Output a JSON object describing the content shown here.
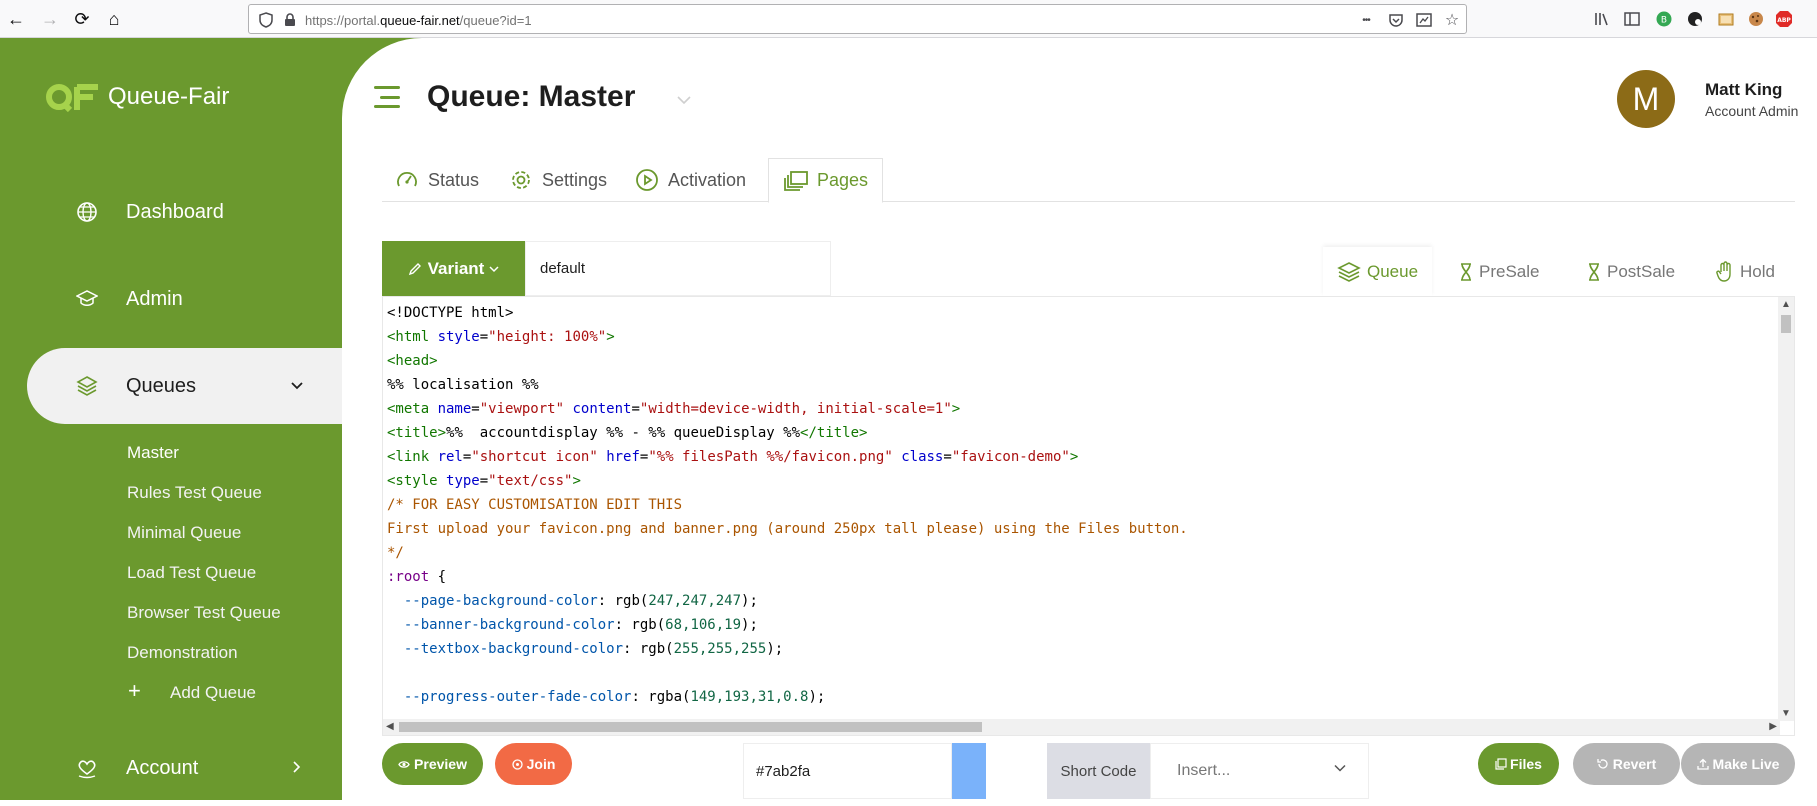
{
  "browser": {
    "back": "←",
    "forward": "→",
    "reload": "⟳",
    "home": "⌂",
    "url_prefix": "https://portal.",
    "url_domain": "queue-fair.net",
    "url_path": "/queue?id=1",
    "more": "•••"
  },
  "sidebar": {
    "brand": "Queue-Fair",
    "nav": [
      {
        "label": "Dashboard",
        "icon": "globe-icon"
      },
      {
        "label": "Admin",
        "icon": "graduation-cap-icon"
      },
      {
        "label": "Queues",
        "icon": "layers-icon"
      },
      {
        "label": "Account",
        "icon": "heart-hand-icon"
      }
    ],
    "queues": [
      "Master",
      "Rules Test Queue",
      "Minimal Queue",
      "Load Test Queue",
      "Browser Test Queue",
      "Demonstration"
    ],
    "add_queue": "Add Queue"
  },
  "header": {
    "title": "Queue: Master",
    "avatar_letter": "M",
    "user_name": "Matt King",
    "user_role": "Account Admin"
  },
  "tabs": [
    "Status",
    "Settings",
    "Activation",
    "Pages"
  ],
  "editor": {
    "variant_label": "Variant",
    "variant_value": "default",
    "page_tabs": [
      "Queue",
      "PreSale",
      "PostSale",
      "Hold"
    ]
  },
  "code": {
    "l1": "<!DOCTYPE html>",
    "l2_tag": "<html ",
    "l2_attr": "style",
    "l2_eq": "=",
    "l2_str": "\"height: 100%\"",
    "l2_end": ">",
    "l3": "<head>",
    "l4": "%% localisation %%",
    "l5_tag": "<meta ",
    "l5_a1": "name",
    "l5_s1": "\"viewport\"",
    "l5_a2": "content",
    "l5_s2": "\"width=device-width, initial-scale=1\"",
    "l5_end": ">",
    "l6_tag": "<title>",
    "l6_text": "%%  accountdisplay %% - %% queueDisplay %%",
    "l6_end": "</title>",
    "l7_tag": "<link ",
    "l7_a1": "rel",
    "l7_s1": "\"shortcut icon\"",
    "l7_a2": "href",
    "l7_s2": "\"%% filesPath %%/favicon.png\"",
    "l7_a3": "class",
    "l7_s3": "\"favicon-demo\"",
    "l7_end": ">",
    "l8_tag": "<style ",
    "l8_a1": "type",
    "l8_s1": "\"text/css\"",
    "l8_end": ">",
    "l9": "/* FOR EASY CUSTOMISATION EDIT THIS",
    "l10": "First upload your favicon.png and banner.png (around 250px tall please) using the Files button.",
    "l11": "*/",
    "l12_sel": ":root",
    "l12_brace": " {",
    "l13_prop": "--page-background-color",
    "l13_fn": ": rgb(",
    "l13_nums": "247,247,247",
    "l13_end": ");",
    "l14_prop": "--banner-background-color",
    "l14_fn": ": rgb(",
    "l14_nums": "68,106,19",
    "l14_end": ");",
    "l15_prop": "--textbox-background-color",
    "l15_fn": ": rgb(",
    "l15_nums": "255,255,255",
    "l15_end": ");",
    "l17_prop": "--progress-outer-fade-color",
    "l17_fn": ": rgba(",
    "l17_nums": "149,193,31,0.8",
    "l17_end": ");"
  },
  "bottom": {
    "preview": "Preview",
    "join": "Join",
    "color_value": "#7ab2fa",
    "shortcode_label": "Short Code",
    "insert_placeholder": "Insert...",
    "files": "Files",
    "revert": "Revert",
    "make_live": "Make Live"
  },
  "colors": {
    "brand_green": "#6b992e",
    "join_orange": "#f26a45",
    "swatch": "#7ab2fa",
    "disabled_grey": "#b5b5b5"
  }
}
